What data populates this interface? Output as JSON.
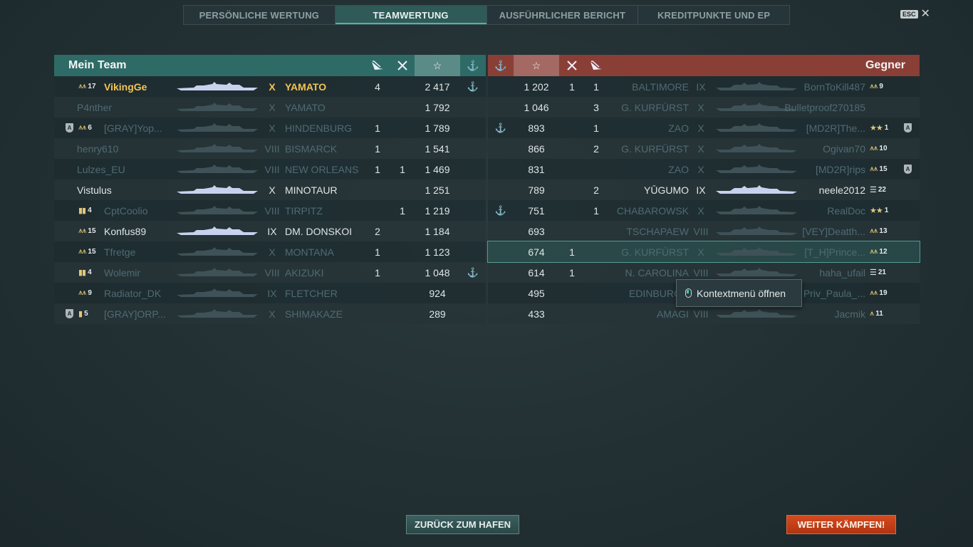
{
  "tabs": [
    {
      "label": "PERSÖNLICHE WERTUNG",
      "active": false
    },
    {
      "label": "TEAMWERTUNG",
      "active": true
    },
    {
      "label": "AUSFÜHRLICHER BERICHT",
      "active": false
    },
    {
      "label": "KREDITPUNKTE UND EP",
      "active": false
    }
  ],
  "esc": {
    "key": "ESC",
    "close": "✕"
  },
  "left_team": {
    "title": "Mein Team",
    "header_icons": [
      "torpedo-hit-icon",
      "ship-destroyed-icon",
      "star-icon",
      "capture-anchor-icon"
    ],
    "rows": [
      {
        "clan": false,
        "rank_badge": "chevrons",
        "rank": "17",
        "name": "VikingGe",
        "tier": "X",
        "ship": "YAMATO",
        "kills": "4",
        "planes": "",
        "score": "2 417",
        "anchor": true,
        "style": "self"
      },
      {
        "clan": false,
        "rank_badge": "",
        "rank": "",
        "name": "P4nther",
        "tier": "X",
        "ship": "YAMATO",
        "kills": "",
        "planes": "",
        "score": "1 792",
        "anchor": false,
        "style": "dead"
      },
      {
        "clan": true,
        "rank_badge": "chevrons",
        "rank": "6",
        "name": "[GRAY]Yop...",
        "tier": "X",
        "ship": "HINDENBURG",
        "kills": "1",
        "planes": "",
        "score": "1 789",
        "anchor": false,
        "style": "dead"
      },
      {
        "clan": false,
        "rank_badge": "",
        "rank": "",
        "name": "henry610",
        "tier": "VIII",
        "ship": "BISMARCK",
        "kills": "1",
        "planes": "",
        "score": "1 541",
        "anchor": false,
        "style": "dead"
      },
      {
        "clan": false,
        "rank_badge": "",
        "rank": "",
        "name": "Lulzes_EU",
        "tier": "VIII",
        "ship": "NEW ORLEANS",
        "kills": "1",
        "planes": "1",
        "score": "1 469",
        "anchor": false,
        "style": "dead"
      },
      {
        "clan": false,
        "rank_badge": "",
        "rank": "",
        "name": "Vistulus",
        "tier": "X",
        "ship": "MINOTAUR",
        "kills": "",
        "planes": "",
        "score": "1 251",
        "anchor": false,
        "style": "alive"
      },
      {
        "clan": false,
        "rank_badge": "bars",
        "rank": "4",
        "name": "CptCoolio",
        "tier": "VIII",
        "ship": "TIRPITZ",
        "kills": "",
        "planes": "1",
        "score": "1 219",
        "anchor": false,
        "style": "dead"
      },
      {
        "clan": false,
        "rank_badge": "chevrons",
        "rank": "15",
        "name": "Konfus89",
        "tier": "IX",
        "ship": "DM. DONSKOI",
        "kills": "2",
        "planes": "",
        "score": "1 184",
        "anchor": false,
        "style": "alive"
      },
      {
        "clan": false,
        "rank_badge": "chevrons",
        "rank": "15",
        "name": "Tfretge",
        "tier": "X",
        "ship": "MONTANA",
        "kills": "1",
        "planes": "",
        "score": "1 123",
        "anchor": false,
        "style": "dead"
      },
      {
        "clan": false,
        "rank_badge": "bars",
        "rank": "4",
        "name": "Wolemir",
        "tier": "VIII",
        "ship": "AKIZUKI",
        "kills": "1",
        "planes": "",
        "score": "1 048",
        "anchor": true,
        "style": "dead"
      },
      {
        "clan": false,
        "rank_badge": "chevrons",
        "rank": "9",
        "name": "Radiator_DK",
        "tier": "IX",
        "ship": "FLETCHER",
        "kills": "",
        "planes": "",
        "score": "924",
        "anchor": false,
        "style": "dead"
      },
      {
        "clan": true,
        "rank_badge": "bar",
        "rank": "5",
        "name": "[GRAY]ORP...",
        "tier": "X",
        "ship": "SHIMAKAZE",
        "kills": "",
        "planes": "",
        "score": "289",
        "anchor": false,
        "style": "dead"
      }
    ]
  },
  "right_team": {
    "title": "Gegner",
    "header_icons": [
      "capture-anchor-icon",
      "star-icon",
      "ship-destroyed-icon",
      "torpedo-hit-icon"
    ],
    "rows": [
      {
        "anchor": false,
        "score": "1 202",
        "planes": "1",
        "kills": "1",
        "ship": "BALTIMORE",
        "tier": "IX",
        "name": "BornToKill487",
        "rank_badge": "chevrons",
        "rank": "9",
        "clan": false,
        "style": "dead"
      },
      {
        "anchor": false,
        "score": "1 046",
        "planes": "",
        "kills": "3",
        "ship": "G. KURFÜRST",
        "tier": "X",
        "name": "Bulletproof270185",
        "rank_badge": "",
        "rank": "",
        "clan": false,
        "style": "dead"
      },
      {
        "anchor": true,
        "score": "893",
        "planes": "",
        "kills": "1",
        "ship": "ZAO",
        "tier": "X",
        "name": "[MD2R]The...",
        "rank_badge": "stars",
        "rank": "1",
        "clan": true,
        "style": "dead"
      },
      {
        "anchor": false,
        "score": "866",
        "planes": "",
        "kills": "2",
        "ship": "G. KURFÜRST",
        "tier": "X",
        "name": "Ogivan70",
        "rank_badge": "chevrons",
        "rank": "10",
        "clan": false,
        "style": "dead"
      },
      {
        "anchor": false,
        "score": "831",
        "planes": "",
        "kills": "",
        "ship": "ZAO",
        "tier": "X",
        "name": "[MD2R]rips",
        "rank_badge": "chevrons",
        "rank": "15",
        "clan": true,
        "style": "dead"
      },
      {
        "anchor": false,
        "score": "789",
        "planes": "",
        "kills": "2",
        "ship": "YŪGUMO",
        "tier": "IX",
        "name": "neele2012",
        "rank_badge": "bars-h",
        "rank": "22",
        "clan": false,
        "style": "alive"
      },
      {
        "anchor": true,
        "score": "751",
        "planes": "",
        "kills": "1",
        "ship": "CHABAROWSK",
        "tier": "X",
        "name": "RealDoc",
        "rank_badge": "stars",
        "rank": "1",
        "clan": false,
        "style": "dead"
      },
      {
        "anchor": false,
        "score": "693",
        "planes": "",
        "kills": "",
        "ship": "TSCHAPAEW",
        "tier": "VIII",
        "name": "[VEY]Deatth...",
        "rank_badge": "chevrons",
        "rank": "13",
        "clan": false,
        "style": "dead"
      },
      {
        "anchor": false,
        "score": "674",
        "planes": "1",
        "kills": "",
        "ship": "G. KURFÜRST",
        "tier": "X",
        "name": "[T_H]Prince...",
        "rank_badge": "chevrons",
        "rank": "12",
        "clan": false,
        "style": "dead",
        "selected": true
      },
      {
        "anchor": false,
        "score": "614",
        "planes": "1",
        "kills": "",
        "ship": "N. CAROLINA",
        "tier": "VIII",
        "name": "haha_ufail",
        "rank_badge": "bars-h",
        "rank": "21",
        "clan": false,
        "style": "dead"
      },
      {
        "anchor": false,
        "score": "495",
        "planes": "",
        "kills": "",
        "ship": "EDINBURGH",
        "tier": "VIII",
        "name": "Priv_Paula_...",
        "rank_badge": "chevrons",
        "rank": "19",
        "clan": false,
        "style": "dead"
      },
      {
        "anchor": false,
        "score": "433",
        "planes": "",
        "kills": "",
        "ship": "AMAGI",
        "tier": "VIII",
        "name": "Jacmik",
        "rank_badge": "chevron",
        "rank": "11",
        "clan": false,
        "style": "dead"
      }
    ]
  },
  "tooltip": {
    "label": "Kontextmenü öffnen",
    "icon": "mouse-icon"
  },
  "buttons": {
    "back": "ZURÜCK ZUM HAFEN",
    "next": "WEITER KÄMPFEN!"
  },
  "colors": {
    "ally_header": "#2e6b66",
    "enemy_header": "#8a3f36",
    "self": "#f3c454",
    "next_button": "#c23e17"
  }
}
